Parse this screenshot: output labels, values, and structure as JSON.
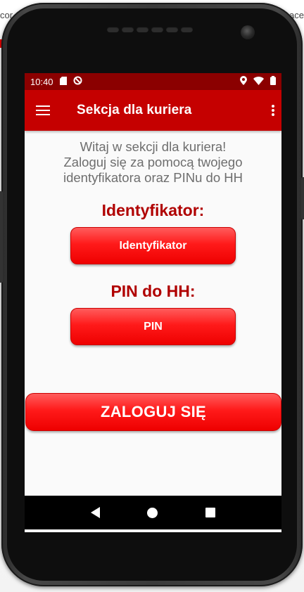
{
  "background": {
    "left_text": "cor",
    "right_text": "ace"
  },
  "status_bar": {
    "time": "10:40"
  },
  "app_bar": {
    "title": "Sekcja dla kuriera"
  },
  "welcome": {
    "line1": "Witaj w sekcji dla kuriera!",
    "line2": "Zaloguj się za pomocą twojego",
    "line3": "identyfikatora oraz PINu do HH"
  },
  "identifier": {
    "label": "Identyfikator:",
    "placeholder": "Identyfikator"
  },
  "pin": {
    "label": "PIN do HH:",
    "placeholder": "PIN"
  },
  "login": {
    "label": "ZALOGUJ SIĘ"
  },
  "colors": {
    "status_bar": "#8b0000",
    "app_bar": "#c50000",
    "label_red": "#b00000",
    "button_red": "#ff1a1a"
  },
  "icons": {
    "menu": "hamburger-menu-icon",
    "overflow": "more-vertical-icon",
    "sd_card": "sd-card-icon",
    "sync": "sync-icon",
    "location": "location-icon",
    "wifi": "wifi-icon",
    "battery": "battery-icon"
  }
}
